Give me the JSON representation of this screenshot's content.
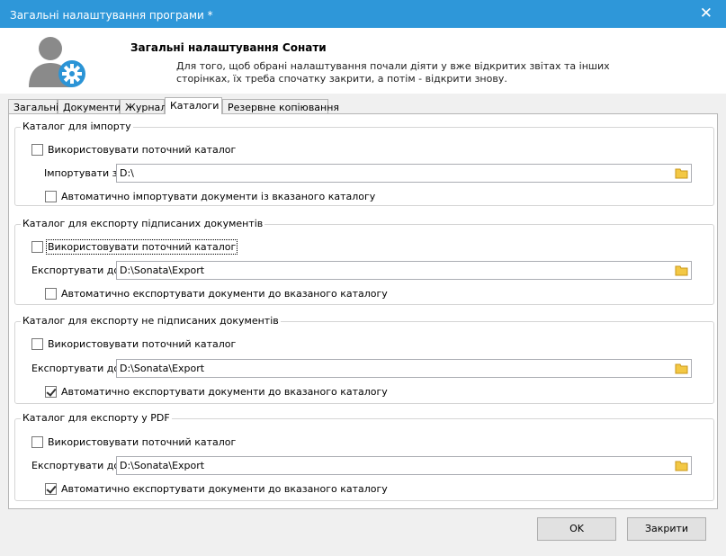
{
  "window": {
    "title": "Загальні налаштування програми *",
    "close_glyph": "✕"
  },
  "header": {
    "title": "Загальні налаштування Сонати",
    "description": "Для того, щоб обрані налаштування почали діяти у вже відкритих звітах та інших сторінках, їх треба спочатку закрити, а потім - відкрити знову.",
    "icon": "user-settings-icon"
  },
  "tabs": [
    {
      "label": "Загальні",
      "active": false
    },
    {
      "label": "Документи",
      "active": false
    },
    {
      "label": "Журнал",
      "active": false
    },
    {
      "label": "Каталоги",
      "active": true
    },
    {
      "label": "Резервне копіювання",
      "active": false
    }
  ],
  "groups": [
    {
      "legend": "Каталог для імпорту",
      "use_current_label": "Використовувати поточний каталог",
      "use_current_checked": false,
      "path_label": "Імпортувати з:",
      "path_value": "D:\\",
      "auto_label": "Автоматично імпортувати документи із вказаного каталогу",
      "auto_checked": false
    },
    {
      "legend": "Каталог для експорту підписаних документів",
      "use_current_label": "Використовувати поточний каталог",
      "use_current_checked": false,
      "path_label": "Експортувати до:",
      "path_value": "D:\\Sonata\\Export",
      "auto_label": "Автоматично експортувати документи до вказаного каталогу",
      "auto_checked": false
    },
    {
      "legend": "Каталог для експорту не підписаних документів",
      "use_current_label": "Використовувати поточний каталог",
      "use_current_checked": false,
      "path_label": "Експортувати до:",
      "path_value": "D:\\Sonata\\Export",
      "auto_label": "Автоматично експортувати документи до вказаного каталогу",
      "auto_checked": true
    },
    {
      "legend": "Каталог для експорту у PDF",
      "use_current_label": "Використовувати поточний каталог",
      "use_current_checked": false,
      "path_label": "Експортувати до:",
      "path_value": "D:\\Sonata\\Export",
      "auto_label": "Автоматично експортувати документи до вказаного каталогу",
      "auto_checked": true
    }
  ],
  "buttons": {
    "ok": "OK",
    "close": "Закрити"
  },
  "colors": {
    "titlebar": "#2e97d9",
    "icon_accent": "#2b94d6",
    "folder": "#f3c844"
  }
}
